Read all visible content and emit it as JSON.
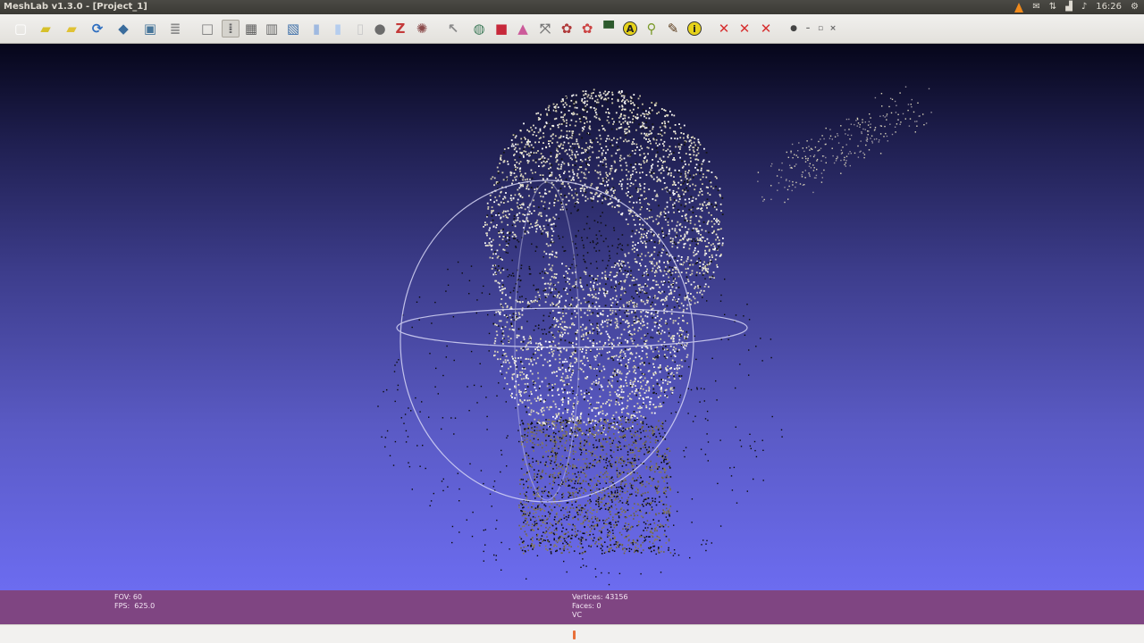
{
  "window": {
    "title": "MeshLab v1.3.0 - [Project_1]",
    "clock": "16:26"
  },
  "toolbar": {
    "items": [
      {
        "name": "new-project-icon",
        "glyph": "▢",
        "color": "#ffffff"
      },
      {
        "name": "open-project-icon",
        "glyph": "▰",
        "color": "#d6c02a"
      },
      {
        "name": "open-mesh-icon",
        "glyph": "▰",
        "color": "#e0c234"
      },
      {
        "name": "reload-icon",
        "glyph": "⟳",
        "color": "#2f6fc0"
      },
      {
        "name": "save-icon",
        "glyph": "◆",
        "color": "#3a6c9c"
      },
      {
        "name": "snapshot-icon",
        "glyph": "▣",
        "color": "#48769a"
      },
      {
        "name": "layers-icon",
        "glyph": "≣",
        "color": "#8a8a8a"
      },
      {
        "name": "bbox-icon",
        "glyph": "□",
        "color": "#7a7a7a"
      },
      {
        "name": "points-icon",
        "glyph": "⁞",
        "color": "#6a6a6a"
      },
      {
        "name": "wireframe-icon",
        "glyph": "▦",
        "color": "#5e5e5e"
      },
      {
        "name": "hidden-lines-icon",
        "glyph": "▥",
        "color": "#6a6a6a"
      },
      {
        "name": "flat-lines-icon",
        "glyph": "▧",
        "color": "#3d6fa9"
      },
      {
        "name": "flat-icon",
        "glyph": "▮",
        "color": "#9fb9e0"
      },
      {
        "name": "smooth-icon",
        "glyph": "▮",
        "color": "#b5cdee"
      },
      {
        "name": "texture-icon",
        "glyph": "▯",
        "color": "#c9c9c9"
      },
      {
        "name": "light-icon",
        "glyph": "●",
        "color": "#6c6c6c"
      },
      {
        "name": "double-side-icon",
        "glyph": "Z",
        "color": "#c43a3a"
      },
      {
        "name": "fancy-light-icon",
        "glyph": "✺",
        "color": "#8a4a4a"
      },
      {
        "name": "select-icon",
        "glyph": "↖",
        "color": "#8a8a8a"
      },
      {
        "name": "shader-icon",
        "glyph": "◍",
        "color": "#3f7a5a"
      },
      {
        "name": "color-icon",
        "glyph": "■",
        "color": "#c7283a"
      },
      {
        "name": "paint-icon",
        "glyph": "▲",
        "color": "#cc5a9a"
      },
      {
        "name": "align-icon",
        "glyph": "⤧",
        "color": "#777777"
      },
      {
        "name": "select-faces-icon",
        "glyph": "✿",
        "color": "#b03a3a"
      },
      {
        "name": "select-vertices-icon",
        "glyph": "✿",
        "color": "#cc4444"
      },
      {
        "name": "measure-icon",
        "glyph": "▀",
        "color": "#2d5a2d"
      },
      {
        "name": "annotate-icon",
        "glyph": "A",
        "color": "#e6d21a"
      },
      {
        "name": "pick-points-icon",
        "glyph": "⚲",
        "color": "#7b9a2a"
      },
      {
        "name": "brush-icon",
        "glyph": "✎",
        "color": "#5a3a1a"
      },
      {
        "name": "info-icon",
        "glyph": "i",
        "color": "#e6d21a"
      },
      {
        "name": "delete-vertex-icon",
        "glyph": "✕",
        "color": "#d63030"
      },
      {
        "name": "delete-face-icon",
        "glyph": "✕",
        "color": "#d63030"
      },
      {
        "name": "delete-both-icon",
        "glyph": "✕",
        "color": "#d63030"
      },
      {
        "name": "camera-icon",
        "glyph": "●",
        "color": "#444444"
      },
      {
        "name": "window-minimize-icon",
        "glyph": "–",
        "color": "#666666"
      },
      {
        "name": "window-restore-icon",
        "glyph": "▫",
        "color": "#666666"
      },
      {
        "name": "window-close-icon",
        "glyph": "×",
        "color": "#666666"
      }
    ]
  },
  "status": {
    "fov_label": "FOV:",
    "fov_value": "60",
    "fps_label": "FPS:",
    "fps_value": "625.0",
    "vertices_label": "Vertices:",
    "vertices_value": "43156",
    "faces_label": "Faces:",
    "faces_value": "0",
    "mode": "VC"
  },
  "colors": {
    "status_bar": "#834686",
    "progress": "#e8703a",
    "trackball": "#d6d6f6"
  }
}
